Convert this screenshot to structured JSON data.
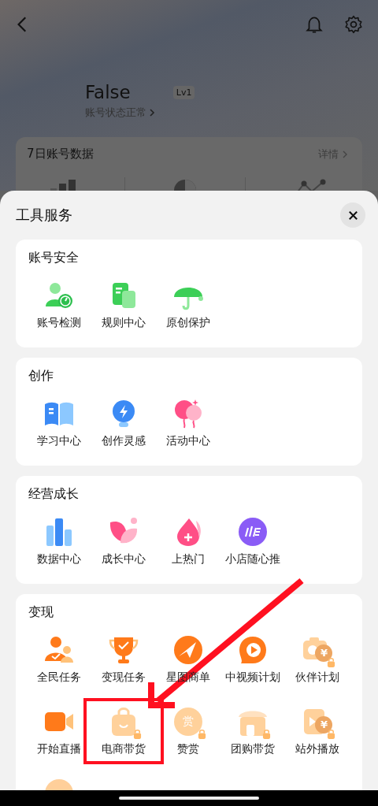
{
  "background_page": {
    "name": "False",
    "level": "Lv1",
    "status": "账号状态正常",
    "data_card": {
      "title": "7日账号数据",
      "details": "详情"
    }
  },
  "sheet": {
    "title": "工具服务",
    "sections": [
      {
        "title": "账号安全",
        "items": [
          {
            "label": "账号检测",
            "locked": false,
            "highlighted": false
          },
          {
            "label": "规则中心",
            "locked": false,
            "highlighted": false
          },
          {
            "label": "原创保护",
            "locked": false,
            "highlighted": false
          }
        ]
      },
      {
        "title": "创作",
        "items": [
          {
            "label": "学习中心",
            "locked": false,
            "highlighted": false
          },
          {
            "label": "创作灵感",
            "locked": false,
            "highlighted": false
          },
          {
            "label": "活动中心",
            "locked": false,
            "highlighted": false
          }
        ]
      },
      {
        "title": "经营成长",
        "items": [
          {
            "label": "数据中心",
            "locked": false,
            "highlighted": false
          },
          {
            "label": "成长中心",
            "locked": false,
            "highlighted": false
          },
          {
            "label": "上热门",
            "locked": false,
            "highlighted": false
          },
          {
            "label": "小店随心推",
            "locked": false,
            "highlighted": false
          }
        ]
      },
      {
        "title": "变现",
        "items": [
          {
            "label": "全民任务",
            "locked": false,
            "highlighted": false
          },
          {
            "label": "变现任务",
            "locked": false,
            "highlighted": false
          },
          {
            "label": "星图商单",
            "locked": false,
            "highlighted": false
          },
          {
            "label": "中视频计划",
            "locked": false,
            "highlighted": false
          },
          {
            "label": "伙伴计划",
            "locked": true,
            "highlighted": false,
            "icon_text": "¥"
          },
          {
            "label": "开始直播",
            "locked": false,
            "highlighted": false
          },
          {
            "label": "电商带货",
            "locked": true,
            "highlighted": true
          },
          {
            "label": "赞赏",
            "locked": true,
            "highlighted": false,
            "icon_text": "赏"
          },
          {
            "label": "团购带货",
            "locked": true,
            "highlighted": false
          },
          {
            "label": "站外播放",
            "locked": true,
            "highlighted": false,
            "icon_text": "¥"
          }
        ]
      }
    ]
  }
}
